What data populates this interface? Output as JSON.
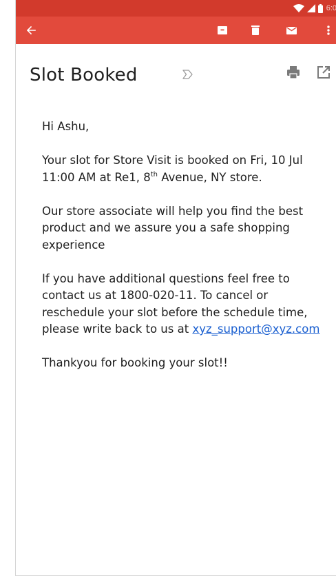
{
  "status_bar": {
    "time": "6:0"
  },
  "app_bar": {
    "icons": [
      "arrow-back-icon",
      "archive-icon",
      "trash-icon",
      "mail-icon",
      "more-vert-icon"
    ]
  },
  "email": {
    "subject": "Slot Booked",
    "greeting": "Hi Ashu,",
    "p1_before": "Your slot for Store Visit is booked on Fri, 10 Jul 11:00 AM at Re1, 8",
    "p1_sup": "th",
    "p1_after": " Avenue, NY store.",
    "p2": "Our store associate will help you find the best product and we assure you a safe shopping experience",
    "p3_text": "If you have additional questions feel free to contact us at 1800-020-11. To cancel or reschedule your slot before the schedule time, please write back to us at ",
    "p3_link": "xyz_support@xyz.com",
    "closing": "Thankyou for booking your slot!!"
  },
  "colors": {
    "status_bar": "#d23a2c",
    "app_bar": "#e24a3c",
    "link": "#1a5fd0"
  }
}
